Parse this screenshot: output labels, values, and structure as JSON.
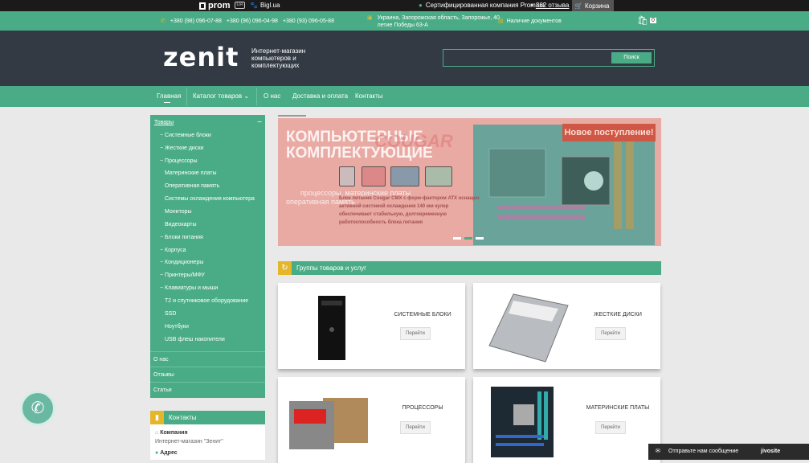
{
  "topbar": {
    "prom": "prom",
    "prom_tag": "UA",
    "bigl": "Bigl.ua",
    "certified": "Сертифицированная компания Prom.ua",
    "reviews": "862 отзыва",
    "cart": "Корзина"
  },
  "infobar": {
    "phones": [
      "+380 (98) 096-07-88",
      "+380 (96) 096-04-98",
      "+380 (93) 096-05-88"
    ],
    "address": "Украина, Запорожская область, Запорожье, 40 летие Победы 63-А",
    "docs": "Наличие документов",
    "cart_count": "0"
  },
  "header": {
    "logo": "zenit",
    "tagline": "Интернет-магазин компьютеров и комплектующих",
    "search_placeholder": "",
    "search_button": "Поиск"
  },
  "nav": {
    "items": [
      "Главная",
      "Каталог товаров",
      "О нас",
      "Доставка и оплата",
      "Контакты"
    ]
  },
  "sidebar": {
    "title": "Товары",
    "categories": [
      {
        "label": "Системные блоки",
        "has_dash": true
      },
      {
        "label": "Жесткие диски",
        "has_dash": true
      },
      {
        "label": "Процессоры",
        "has_dash": true
      },
      {
        "label": "Материнские платы",
        "has_dash": false
      },
      {
        "label": "Оперативная память",
        "has_dash": false
      },
      {
        "label": "Системы охлаждения компьютера",
        "has_dash": false
      },
      {
        "label": "Мониторы",
        "has_dash": false
      },
      {
        "label": "Видеокарты",
        "has_dash": false
      },
      {
        "label": "Блоки питания",
        "has_dash": true
      },
      {
        "label": "Корпуса",
        "has_dash": true
      },
      {
        "label": "Кондиционеры",
        "has_dash": true
      },
      {
        "label": "Принтеры/МФУ",
        "has_dash": true
      },
      {
        "label": "Клавиатуры и мыши",
        "has_dash": true
      },
      {
        "label": "Т2 и спутниковое оборудование",
        "has_dash": false
      },
      {
        "label": "SSD",
        "has_dash": false
      },
      {
        "label": "Ноутбуки",
        "has_dash": false
      },
      {
        "label": "USB флеш накопители",
        "has_dash": false
      }
    ],
    "links": [
      "О нас",
      "Отзывы",
      "Статьи"
    ]
  },
  "banner": {
    "title_line1": "КОМПЬЮТЕРНЫЕ",
    "title_line2": "КОМПЛЕКТУЮЩИЕ",
    "brand": "COUGAR",
    "new_badge": "Новое поступление!",
    "sub_line1": "процессоры, материнские платы",
    "sub_line2": "оперативная память",
    "description": "Блок питания Cougar CMX с форм-фактором ATX оснащен активной системой охлаждения 140 мм кулер обеспечивает стабильную, долговременную работоспособность блока питания"
  },
  "section": {
    "title": "Группы товаров и услуг"
  },
  "products": [
    {
      "name": "СИСТЕМНЫЕ БЛОКИ",
      "button": "Перейти",
      "icon": "pc-tower-icon"
    },
    {
      "name": "ЖЕСТКИЕ ДИСКИ",
      "button": "Перейти",
      "icon": "hard-drive-icon"
    },
    {
      "name": "ПРОЦЕССОРЫ",
      "button": "Перейти",
      "icon": "cpu-icon"
    },
    {
      "name": "МАТЕРИНСКИЕ ПЛАТЫ",
      "button": "Перейти",
      "icon": "motherboard-icon"
    }
  ],
  "contacts": {
    "title": "Контакты",
    "company_label": "Компания",
    "company_value": "Интернет-магазин \"Зенит\"",
    "address_label": "Адрес"
  },
  "jivo": {
    "text": "Отправьте нам сообщение",
    "brand": "jivosite"
  },
  "colors": {
    "green": "#4aac86",
    "dark": "#333a44",
    "accent_yellow": "#e5b52a"
  }
}
